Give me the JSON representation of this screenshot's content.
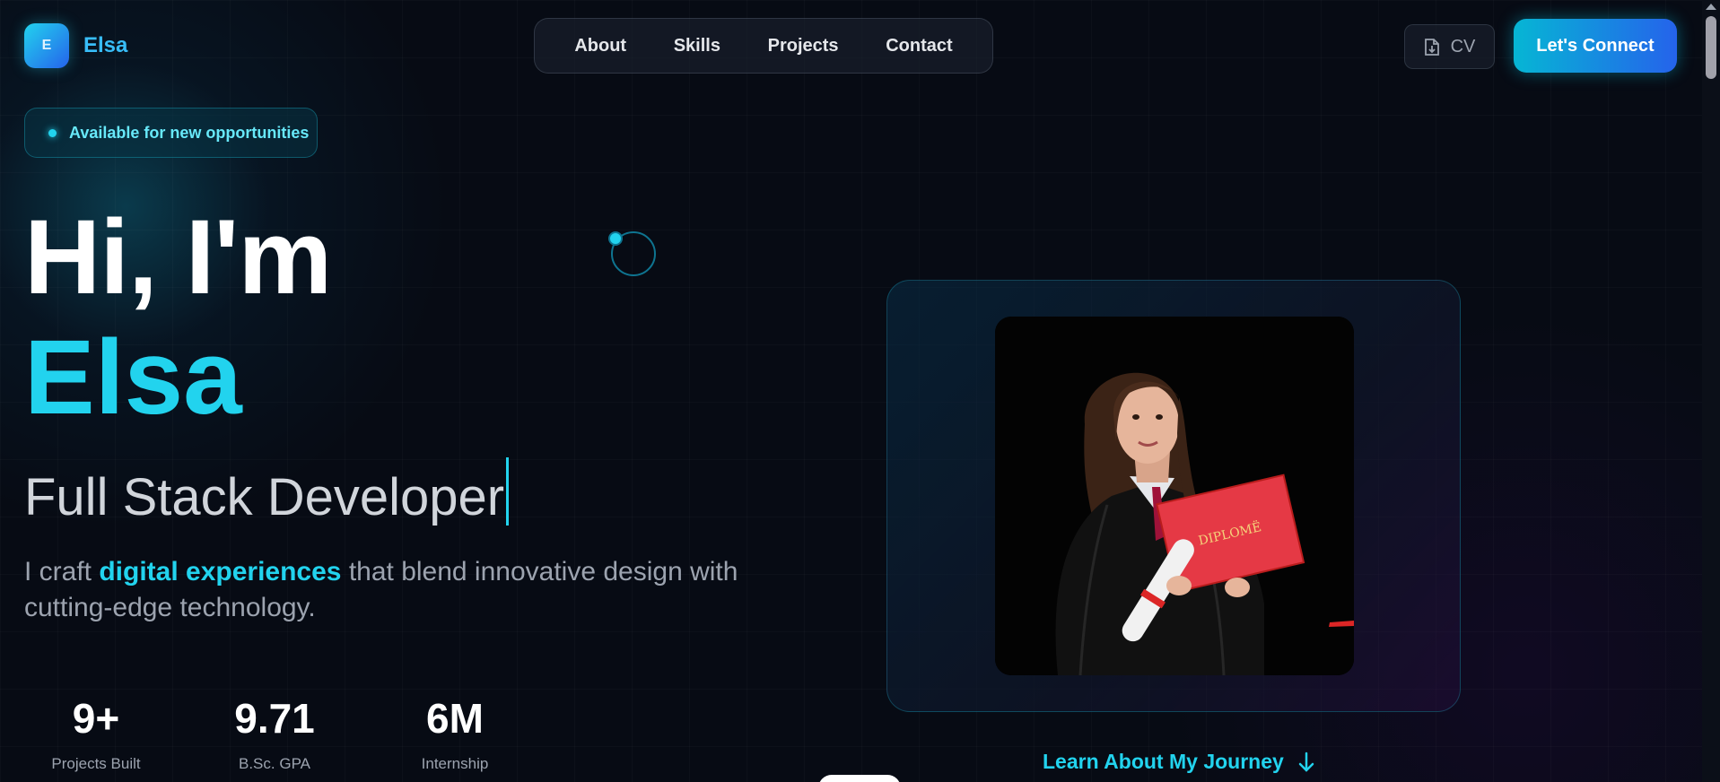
{
  "header": {
    "logo_letter": "E",
    "logo_name": "Elsa",
    "nav": [
      "About",
      "Skills",
      "Projects",
      "Contact"
    ],
    "cv_label": "CV",
    "cta_label": "Let's Connect"
  },
  "hero": {
    "availability": "Available for new opportunities",
    "greeting": "Hi, I'm",
    "name": "Elsa",
    "role": "Full Stack Developer",
    "desc_pre": "I craft ",
    "desc_highlight": "digital experiences",
    "desc_post": " that blend innovative design with cutting-edge technology.",
    "stats": [
      {
        "value": "9+",
        "label": "Projects Built"
      },
      {
        "value": "9.71",
        "label": "B.Sc. GPA"
      },
      {
        "value": "6M",
        "label": "Internship"
      }
    ]
  },
  "photo": {
    "diploma_text": "DIPLOMË"
  },
  "journey_link": "Learn About My Journey",
  "colors": {
    "background": "#070b14",
    "accent": "#22d3ee",
    "accent_blue": "#2563eb"
  },
  "icons": {
    "cv": "file-download-icon",
    "journey": "arrow-down-icon",
    "availability": "status-dot-icon"
  }
}
